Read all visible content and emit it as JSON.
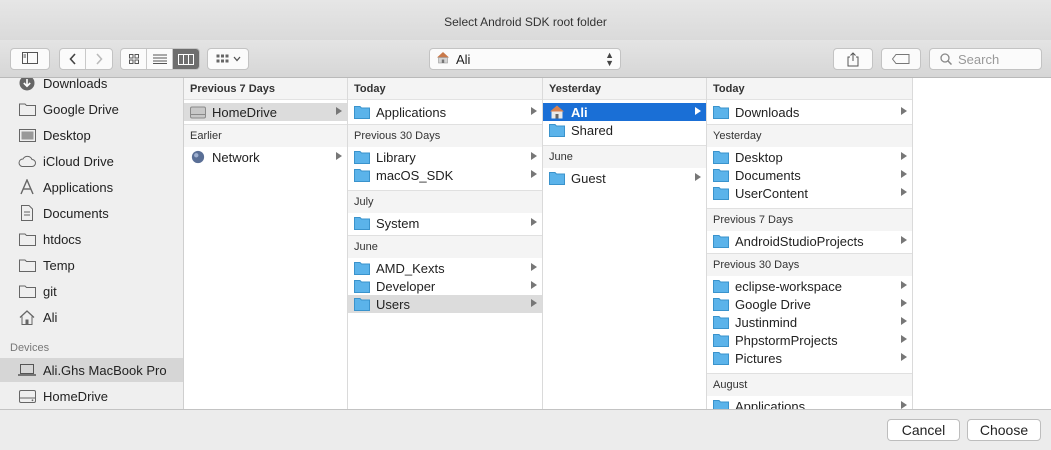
{
  "window": {
    "title": "Select Android SDK root folder"
  },
  "toolbar": {
    "path_label": "Ali",
    "search_placeholder": "Search",
    "view_mode_selected": "column"
  },
  "sidebar": {
    "favorites": [
      "Downloads",
      "Google Drive",
      "Desktop",
      "iCloud Drive",
      "Applications",
      "Documents",
      "htdocs",
      "Temp",
      "git",
      "Ali"
    ],
    "devices_header": "Devices",
    "devices": [
      "Ali.Ghs MacBook Pro",
      "HomeDrive"
    ]
  },
  "columns": [
    {
      "groups": [
        {
          "header": "Previous 7 Days",
          "items": [
            {
              "label": "HomeDrive",
              "icon": "drive-icon",
              "state": "dim"
            }
          ]
        },
        {
          "header": "Earlier",
          "items": [
            {
              "label": "Network",
              "icon": "globe-icon"
            }
          ]
        }
      ]
    },
    {
      "groups": [
        {
          "header": "Today",
          "items": [
            {
              "label": "Applications",
              "icon": "folder-icon"
            }
          ]
        },
        {
          "header": "Previous 30 Days",
          "items": [
            {
              "label": "Library",
              "icon": "folder-icon"
            },
            {
              "label": "macOS_SDK",
              "icon": "folder-icon"
            }
          ]
        },
        {
          "header": "July",
          "items": [
            {
              "label": "System",
              "icon": "folder-icon"
            }
          ]
        },
        {
          "header": "June",
          "items": [
            {
              "label": "AMD_Kexts",
              "icon": "folder-icon"
            },
            {
              "label": "Developer",
              "icon": "folder-icon"
            },
            {
              "label": "Users",
              "icon": "folder-icon",
              "state": "dim"
            }
          ]
        }
      ]
    },
    {
      "groups": [
        {
          "header": "Yesterday",
          "items": [
            {
              "label": "Ali",
              "icon": "home-icon",
              "state": "selected"
            },
            {
              "label": "Shared",
              "icon": "folder-icon"
            }
          ]
        },
        {
          "header": "June",
          "items": [
            {
              "label": "Guest",
              "icon": "folder-icon"
            }
          ]
        }
      ]
    },
    {
      "groups": [
        {
          "header": "Today",
          "items": [
            {
              "label": "Downloads",
              "icon": "folder-icon"
            }
          ]
        },
        {
          "header": "Yesterday",
          "items": [
            {
              "label": "Desktop",
              "icon": "folder-icon"
            },
            {
              "label": "Documents",
              "icon": "folder-icon"
            },
            {
              "label": "UserContent",
              "icon": "folder-icon"
            }
          ]
        },
        {
          "header": "Previous 7 Days",
          "items": [
            {
              "label": "AndroidStudioProjects",
              "icon": "folder-icon"
            }
          ]
        },
        {
          "header": "Previous 30 Days",
          "items": [
            {
              "label": "eclipse-workspace",
              "icon": "folder-icon"
            },
            {
              "label": "Google Drive",
              "icon": "folder-icon"
            },
            {
              "label": "Justinmind",
              "icon": "folder-icon"
            },
            {
              "label": "PhpstormProjects",
              "icon": "folder-icon"
            },
            {
              "label": "Pictures",
              "icon": "folder-icon"
            }
          ]
        },
        {
          "header": "August",
          "items": [
            {
              "label": "Applications",
              "icon": "folder-icon"
            }
          ]
        }
      ]
    }
  ],
  "footer": {
    "cancel_label": "Cancel",
    "choose_label": "Choose"
  },
  "colors": {
    "selection": "#1a6fd6",
    "folder": "#5bb3ea"
  }
}
